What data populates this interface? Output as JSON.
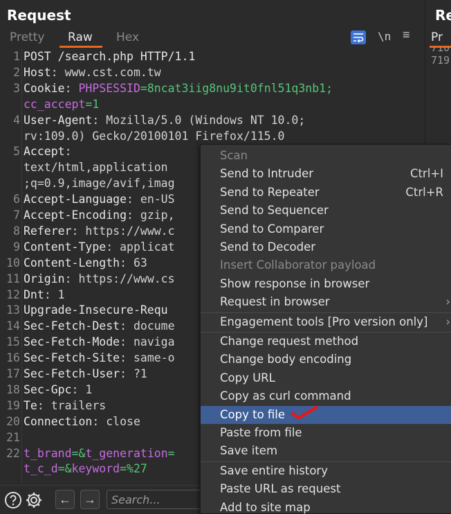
{
  "request_panel": {
    "title": "Request",
    "tabs": [
      "Pretty",
      "Raw",
      "Hex"
    ],
    "active_tab": "Raw",
    "newline_toggle": "\\n"
  },
  "response_panel": {
    "title": "Re",
    "tab": "Pr",
    "lines": [
      "710",
      "719"
    ]
  },
  "editor_lines": [
    {
      "n": "1",
      "parts": [
        {
          "t": "POST /search.php HTTP/1.1",
          "c": "hk"
        }
      ]
    },
    {
      "n": "2",
      "parts": [
        {
          "t": "Host",
          "c": "hk"
        },
        {
          "t": ": www.cst.com.tw",
          "c": "hv"
        }
      ]
    },
    {
      "n": "3",
      "parts": [
        {
          "t": "Cookie",
          "c": "hk"
        },
        {
          "t": ": ",
          "c": "hv"
        },
        {
          "t": "PHPSESSID",
          "c": "ck"
        },
        {
          "t": "=8ncat3iig8nu9it0fnl51q3nb1;",
          "c": "cv"
        }
      ]
    },
    {
      "n": "",
      "parts": [
        {
          "t": "cc_accept",
          "c": "ck"
        },
        {
          "t": "=1",
          "c": "cv"
        }
      ]
    },
    {
      "n": "4",
      "parts": [
        {
          "t": "User-Agent",
          "c": "hk"
        },
        {
          "t": ": Mozilla/5.0 (Windows NT 10.0;",
          "c": "hv"
        }
      ]
    },
    {
      "n": "",
      "parts": [
        {
          "t": "rv:109.0) Gecko/20100101 Firefox/115.0",
          "c": "hv"
        }
      ]
    },
    {
      "n": "5",
      "parts": [
        {
          "t": "Accept",
          "c": "hk"
        },
        {
          "t": ":",
          "c": "hv"
        }
      ]
    },
    {
      "n": "",
      "parts": [
        {
          "t": "text/html,application",
          "c": "hv"
        }
      ]
    },
    {
      "n": "",
      "parts": [
        {
          "t": ";q=0.9,image/avif,imag",
          "c": "hv"
        }
      ]
    },
    {
      "n": "6",
      "parts": [
        {
          "t": "Accept-Language",
          "c": "hk"
        },
        {
          "t": ": en-US",
          "c": "hv"
        }
      ]
    },
    {
      "n": "7",
      "parts": [
        {
          "t": "Accept-Encoding",
          "c": "hk"
        },
        {
          "t": ": gzip,",
          "c": "hv"
        }
      ]
    },
    {
      "n": "8",
      "parts": [
        {
          "t": "Referer",
          "c": "hk"
        },
        {
          "t": ": https://www.c",
          "c": "hv"
        }
      ]
    },
    {
      "n": "9",
      "parts": [
        {
          "t": "Content-Type",
          "c": "hk"
        },
        {
          "t": ": applicat",
          "c": "hv"
        }
      ]
    },
    {
      "n": "10",
      "parts": [
        {
          "t": "Content-Length",
          "c": "hk"
        },
        {
          "t": ": 63",
          "c": "hv"
        }
      ]
    },
    {
      "n": "11",
      "parts": [
        {
          "t": "Origin",
          "c": "hk"
        },
        {
          "t": ": https://www.cs",
          "c": "hv"
        }
      ]
    },
    {
      "n": "12",
      "parts": [
        {
          "t": "Dnt",
          "c": "hk"
        },
        {
          "t": ": 1",
          "c": "hv"
        }
      ]
    },
    {
      "n": "13",
      "parts": [
        {
          "t": "Upgrade-Insecure-Requ",
          "c": "hk"
        }
      ]
    },
    {
      "n": "14",
      "parts": [
        {
          "t": "Sec-Fetch-Dest",
          "c": "hk"
        },
        {
          "t": ": docume",
          "c": "hv"
        }
      ]
    },
    {
      "n": "15",
      "parts": [
        {
          "t": "Sec-Fetch-Mode",
          "c": "hk"
        },
        {
          "t": ": naviga",
          "c": "hv"
        }
      ]
    },
    {
      "n": "16",
      "parts": [
        {
          "t": "Sec-Fetch-Site",
          "c": "hk"
        },
        {
          "t": ": same-o",
          "c": "hv"
        }
      ]
    },
    {
      "n": "17",
      "parts": [
        {
          "t": "Sec-Fetch-User",
          "c": "hk"
        },
        {
          "t": ": ?1",
          "c": "hv"
        }
      ]
    },
    {
      "n": "18",
      "parts": [
        {
          "t": "Sec-Gpc",
          "c": "hk"
        },
        {
          "t": ": 1",
          "c": "hv"
        }
      ]
    },
    {
      "n": "19",
      "parts": [
        {
          "t": "Te",
          "c": "hk"
        },
        {
          "t": ": trailers",
          "c": "hv"
        }
      ]
    },
    {
      "n": "20",
      "parts": [
        {
          "t": "Connection",
          "c": "hk"
        },
        {
          "t": ": close",
          "c": "hv"
        }
      ]
    },
    {
      "n": "21",
      "parts": []
    },
    {
      "n": "22",
      "parts": [
        {
          "t": "t_brand",
          "c": "ck"
        },
        {
          "t": "=&",
          "c": "cv"
        },
        {
          "t": "t_generation",
          "c": "ck"
        },
        {
          "t": "=",
          "c": "cv"
        }
      ]
    },
    {
      "n": "",
      "parts": [
        {
          "t": "t_c_d",
          "c": "ck"
        },
        {
          "t": "=&",
          "c": "cv"
        },
        {
          "t": "keyword",
          "c": "ck"
        },
        {
          "t": "=%27",
          "c": "cv"
        }
      ]
    }
  ],
  "search": {
    "placeholder": "Search..."
  },
  "context_menu": {
    "items": [
      {
        "label": "Scan",
        "disabled": true
      },
      {
        "label": "Send to Intruder",
        "shortcut": "Ctrl+I"
      },
      {
        "label": "Send to Repeater",
        "shortcut": "Ctrl+R"
      },
      {
        "label": "Send to Sequencer"
      },
      {
        "label": "Send to Comparer"
      },
      {
        "label": "Send to Decoder"
      },
      {
        "label": "Insert Collaborator payload",
        "disabled": true
      },
      {
        "label": "Show response in browser"
      },
      {
        "label": "Request in browser",
        "submenu": true
      },
      {
        "label": "Engagement tools [Pro version only]",
        "submenu": true,
        "divider_before": true
      },
      {
        "label": "Change request method",
        "divider_before": true
      },
      {
        "label": "Change body encoding"
      },
      {
        "label": "Copy URL"
      },
      {
        "label": "Copy as curl command"
      },
      {
        "label": "Copy to file",
        "highlight": true
      },
      {
        "label": "Paste from file"
      },
      {
        "label": "Save item"
      },
      {
        "label": "Save entire history",
        "divider_before": true
      },
      {
        "label": "Paste URL as request"
      },
      {
        "label": "Add to site map"
      }
    ]
  },
  "colors": {
    "accent_orange": "#e8671f",
    "menu_highlight": "#3e5e96",
    "cookie_key": "#c66be0",
    "cookie_value": "#56c47a",
    "annotation_check": "#e01a1a"
  }
}
